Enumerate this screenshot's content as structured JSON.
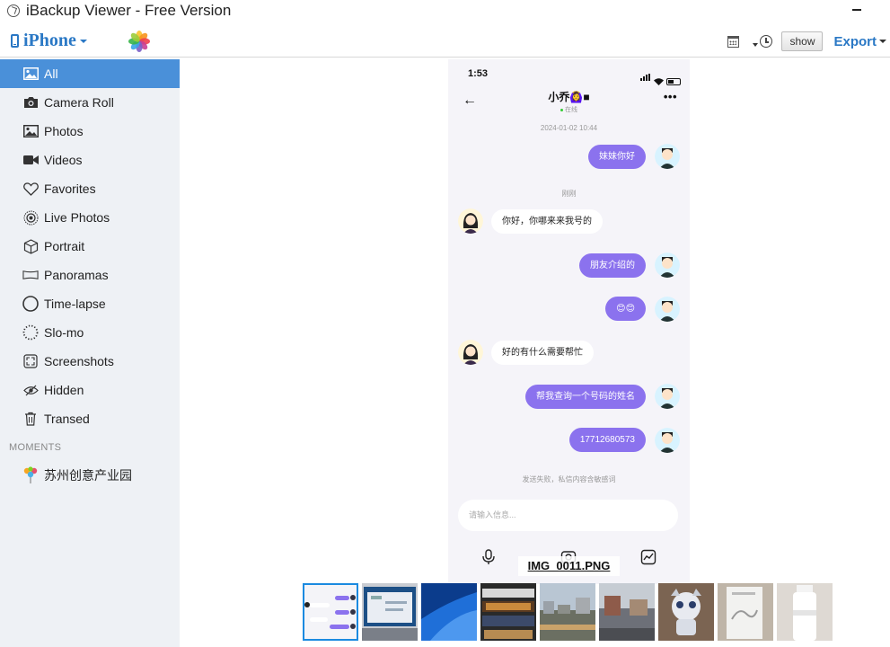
{
  "window": {
    "title": "iBackup Viewer - Free Version"
  },
  "toolbar": {
    "device_name": "iPhone",
    "show_label": "show",
    "export_label": "Export"
  },
  "sidebar": {
    "items": [
      {
        "label": "All",
        "icon": "photo-icon",
        "active": true
      },
      {
        "label": "Camera Roll",
        "icon": "camera-icon"
      },
      {
        "label": "Photos",
        "icon": "photo-icon"
      },
      {
        "label": "Videos",
        "icon": "video-icon"
      },
      {
        "label": "Favorites",
        "icon": "heart-icon"
      },
      {
        "label": "Live Photos",
        "icon": "live-photo-icon"
      },
      {
        "label": "Portrait",
        "icon": "cube-icon"
      },
      {
        "label": "Panoramas",
        "icon": "panorama-icon"
      },
      {
        "label": "Time-lapse",
        "icon": "timelapse-icon"
      },
      {
        "label": "Slo-mo",
        "icon": "slomo-icon"
      },
      {
        "label": "Screenshots",
        "icon": "screenshot-icon"
      },
      {
        "label": "Hidden",
        "icon": "eye-slash-icon"
      },
      {
        "label": "Transed",
        "icon": "trash-icon"
      }
    ],
    "moments_label": "MOMENTS",
    "moments": [
      {
        "label": "苏州创意产业园",
        "icon": "pin-icon"
      }
    ]
  },
  "preview": {
    "filename": "IMG_0011.PNG",
    "status_time": "1:53",
    "chat_title": "小乔🙆‍♀️■",
    "chat_status": "在线",
    "timestamp": "2024-01-02 10:44",
    "just_now": "刚刚",
    "messages": [
      {
        "from": "me",
        "text": "妹妹你好"
      },
      {
        "from": "them",
        "text": "你好，你哪来来我号的"
      },
      {
        "from": "me",
        "text": "朋友介绍的"
      },
      {
        "from": "me",
        "text": "😊😊"
      },
      {
        "from": "them",
        "text": "好的有什么需要帮忙"
      },
      {
        "from": "me",
        "text": "帮我查询一个号码的姓名"
      },
      {
        "from": "me",
        "text": "17712680573"
      }
    ],
    "send_failed": "发送失败，私信内容含敏感词",
    "input_placeholder": "请输入信息..."
  },
  "thumbnails": [
    {
      "name": "chat-screenshot",
      "selected": true
    },
    {
      "name": "monitor-photo"
    },
    {
      "name": "desktop-wallpaper"
    },
    {
      "name": "bookshelf-photo"
    },
    {
      "name": "campus-view"
    },
    {
      "name": "street-view"
    },
    {
      "name": "mascot-figure"
    },
    {
      "name": "paper-document"
    },
    {
      "name": "white-bottle"
    }
  ],
  "colors": {
    "accent": "#4a90d9",
    "link": "#2a78c5",
    "bubble_me": "#8b72ee"
  }
}
